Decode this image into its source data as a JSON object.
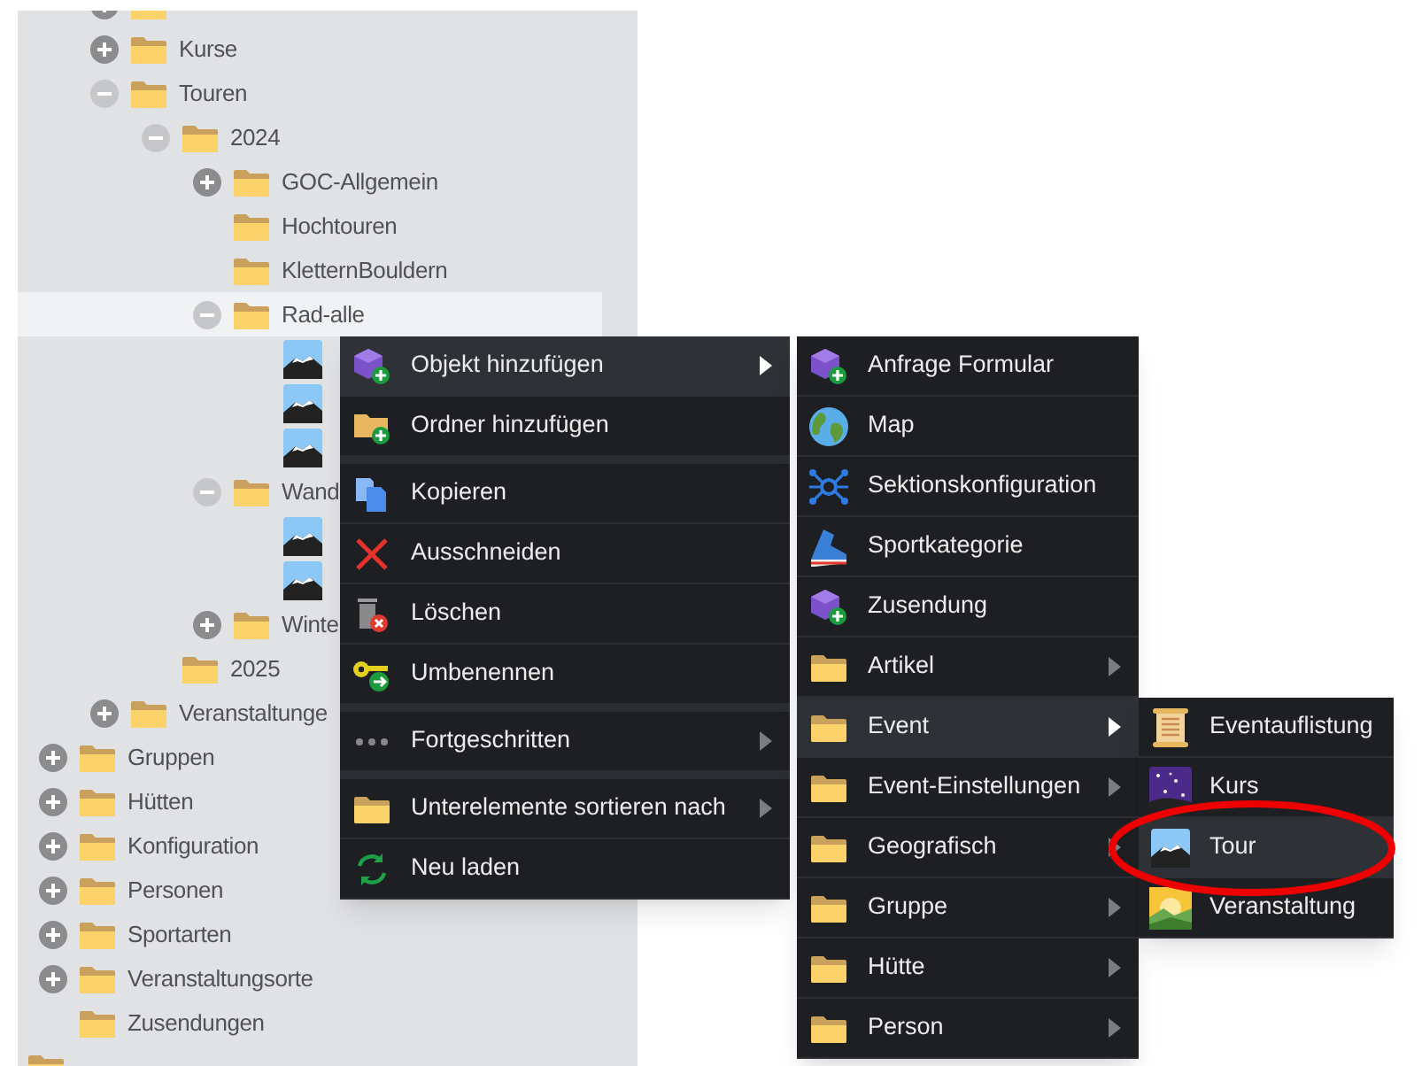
{
  "tree": {
    "items": [
      {
        "children": [
          {
            "children": [
              {
                "kind": "folder",
                "expanded": false,
                "selected": false
              },
              {
                "label": "Kurse",
                "kind": "folder",
                "expanded": false,
                "selected": false
              },
              {
                "label": "Touren",
                "kind": "folder",
                "expanded": true,
                "selected": false,
                "children": [
                  {
                    "label": "2024",
                    "kind": "folder",
                    "expanded": true,
                    "selected": false,
                    "children": [
                      {
                        "label": "GOC-Allgemein",
                        "kind": "folder",
                        "expanded": false,
                        "selected": false
                      },
                      {
                        "label": "Hochtouren",
                        "kind": "folder",
                        "selected": false
                      },
                      {
                        "label": "KletternBouldern",
                        "kind": "folder",
                        "selected": false
                      },
                      {
                        "label": "Rad-alle",
                        "kind": "folder",
                        "expanded": true,
                        "selected": true,
                        "children": [
                          {
                            "kind": "tour",
                            "selected": false
                          },
                          {
                            "kind": "tour",
                            "selected": false
                          },
                          {
                            "kind": "tour",
                            "selected": false
                          }
                        ]
                      },
                      {
                        "label": "Wand",
                        "kind": "folder",
                        "expanded": true,
                        "selected": false,
                        "children": [
                          {
                            "kind": "tour",
                            "selected": false
                          },
                          {
                            "kind": "tour",
                            "selected": false
                          }
                        ]
                      },
                      {
                        "label": "Winte",
                        "kind": "folder",
                        "expanded": false,
                        "selected": false
                      }
                    ]
                  },
                  {
                    "label": "2025",
                    "kind": "folder",
                    "selected": false
                  }
                ]
              },
              {
                "label": "Veranstaltunge",
                "kind": "folder",
                "expanded": false,
                "selected": false
              }
            ]
          },
          {
            "label": "Gruppen",
            "kind": "folder",
            "expanded": false,
            "selected": false
          },
          {
            "label": "Hütten",
            "kind": "folder",
            "expanded": false,
            "selected": false
          },
          {
            "label": "Konfiguration",
            "kind": "folder",
            "expanded": false,
            "selected": false
          },
          {
            "label": "Personen",
            "kind": "folder",
            "expanded": false,
            "selected": false
          },
          {
            "label": "Sportarten",
            "kind": "folder",
            "expanded": false,
            "selected": false
          },
          {
            "label": "Veranstaltungsorte",
            "kind": "folder",
            "expanded": false,
            "selected": false
          },
          {
            "label": "Zusendungen",
            "kind": "folder",
            "selected": false
          }
        ]
      },
      {
        "kind": "folder",
        "selected": false
      }
    ]
  },
  "context_menu": {
    "groups": [
      [
        {
          "label": "Objekt hinzufügen",
          "selected": true,
          "submenu": true
        },
        {
          "label": "Ordner hinzufügen",
          "selected": false,
          "submenu": false
        }
      ],
      [
        {
          "label": "Kopieren",
          "selected": false,
          "submenu": false
        },
        {
          "label": "Ausschneiden",
          "selected": false,
          "submenu": false
        },
        {
          "label": "Löschen",
          "selected": false,
          "submenu": false
        },
        {
          "label": "Umbenennen",
          "selected": false,
          "submenu": false
        }
      ],
      [
        {
          "label": "Fortgeschritten",
          "selected": false,
          "submenu": true
        }
      ],
      [
        {
          "label": "Unterelemente sortieren nach",
          "selected": false,
          "submenu": true
        },
        {
          "label": "Neu laden",
          "selected": false,
          "submenu": false
        }
      ]
    ]
  },
  "submenu": {
    "items": [
      {
        "label": "Anfrage Formular",
        "selected": false,
        "submenu": false
      },
      {
        "label": "Map",
        "selected": false,
        "submenu": false
      },
      {
        "label": "Sektionskonfiguration",
        "selected": false,
        "submenu": false
      },
      {
        "label": "Sportkategorie",
        "selected": false,
        "submenu": false
      },
      {
        "label": "Zusendung",
        "selected": false,
        "submenu": false
      },
      {
        "label": "Artikel",
        "selected": false,
        "submenu": true
      },
      {
        "label": "Event",
        "selected": true,
        "submenu": true
      },
      {
        "label": "Event-Einstellungen",
        "selected": false,
        "submenu": true
      },
      {
        "label": "Geografisch",
        "selected": false,
        "submenu": true
      },
      {
        "label": "Gruppe",
        "selected": false,
        "submenu": true
      },
      {
        "label": "Hütte",
        "selected": false,
        "submenu": true
      },
      {
        "label": "Person",
        "selected": false,
        "submenu": true
      }
    ]
  },
  "submenu_2": {
    "items": [
      {
        "label": "Eventauflistung",
        "selected": false,
        "circled": false
      },
      {
        "label": "Kurs",
        "selected": false,
        "circled": false
      },
      {
        "label": "Tour",
        "selected": true,
        "circled": true
      },
      {
        "label": "Veranstaltung",
        "selected": false,
        "circled": false
      }
    ]
  }
}
